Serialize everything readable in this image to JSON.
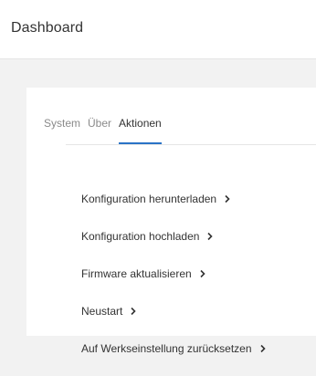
{
  "header": {
    "title": "Dashboard"
  },
  "tabs": [
    {
      "label": "System"
    },
    {
      "label": "Über"
    },
    {
      "label": "Aktionen"
    }
  ],
  "actions": [
    {
      "label": "Konfiguration herunterladen",
      "icon": "chevron-right-icon"
    },
    {
      "label": "Konfiguration hochladen",
      "icon": "chevron-right-icon"
    },
    {
      "label": "Firmware aktualisieren",
      "icon": "chevron-right-icon"
    },
    {
      "label": "Neustart",
      "icon": "chevron-right-icon"
    },
    {
      "label": "Auf Werkseinstellung zurücksetzen",
      "icon": "chevron-right-icon"
    }
  ],
  "colors": {
    "background": "#f2f2f2",
    "card": "#ffffff",
    "active_tab_underline": "#2a73c6",
    "text": "#333333",
    "muted_text": "#8a8a8a"
  }
}
